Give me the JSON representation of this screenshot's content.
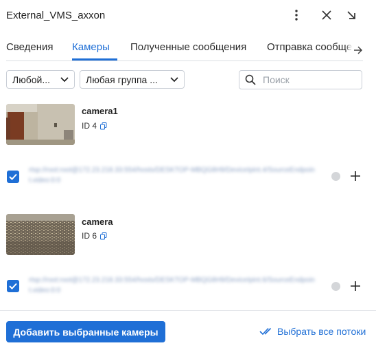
{
  "window": {
    "title": "External_VMS_axxon"
  },
  "tabs": [
    {
      "label": "Сведения"
    },
    {
      "label": "Камеры"
    },
    {
      "label": "Полученные сообщения"
    },
    {
      "label": "Отправка сообщений"
    }
  ],
  "active_tab": "Камеры",
  "filters": {
    "type_select": "Любой...",
    "group_select": "Любая группа ...",
    "search_placeholder": "Поиск"
  },
  "cameras": [
    {
      "name": "camera1",
      "id": "ID 4",
      "stream_url": "rtsp://root:root@172.23.218.33:554/hosts/DESKTOP-MBQG8H9/DeviceIpint.4/SourceEndpoint.video:0:0",
      "stream_selected": true
    },
    {
      "name": "camera",
      "id": "ID 6",
      "stream_url": "rtsp://root:root@172.23.218.33:554/hosts/DESKTOP-MBQG8H9/DeviceIpint.6/SourceEndpoint.video:0:0",
      "stream_selected": true
    }
  ],
  "footer": {
    "add_button": "Добавить выбранные камеры",
    "select_all": "Выбрать все потоки"
  },
  "colors": {
    "accent": "#1f6fd6",
    "border": "#c9ced6",
    "status_dot": "#d4d6d9"
  }
}
